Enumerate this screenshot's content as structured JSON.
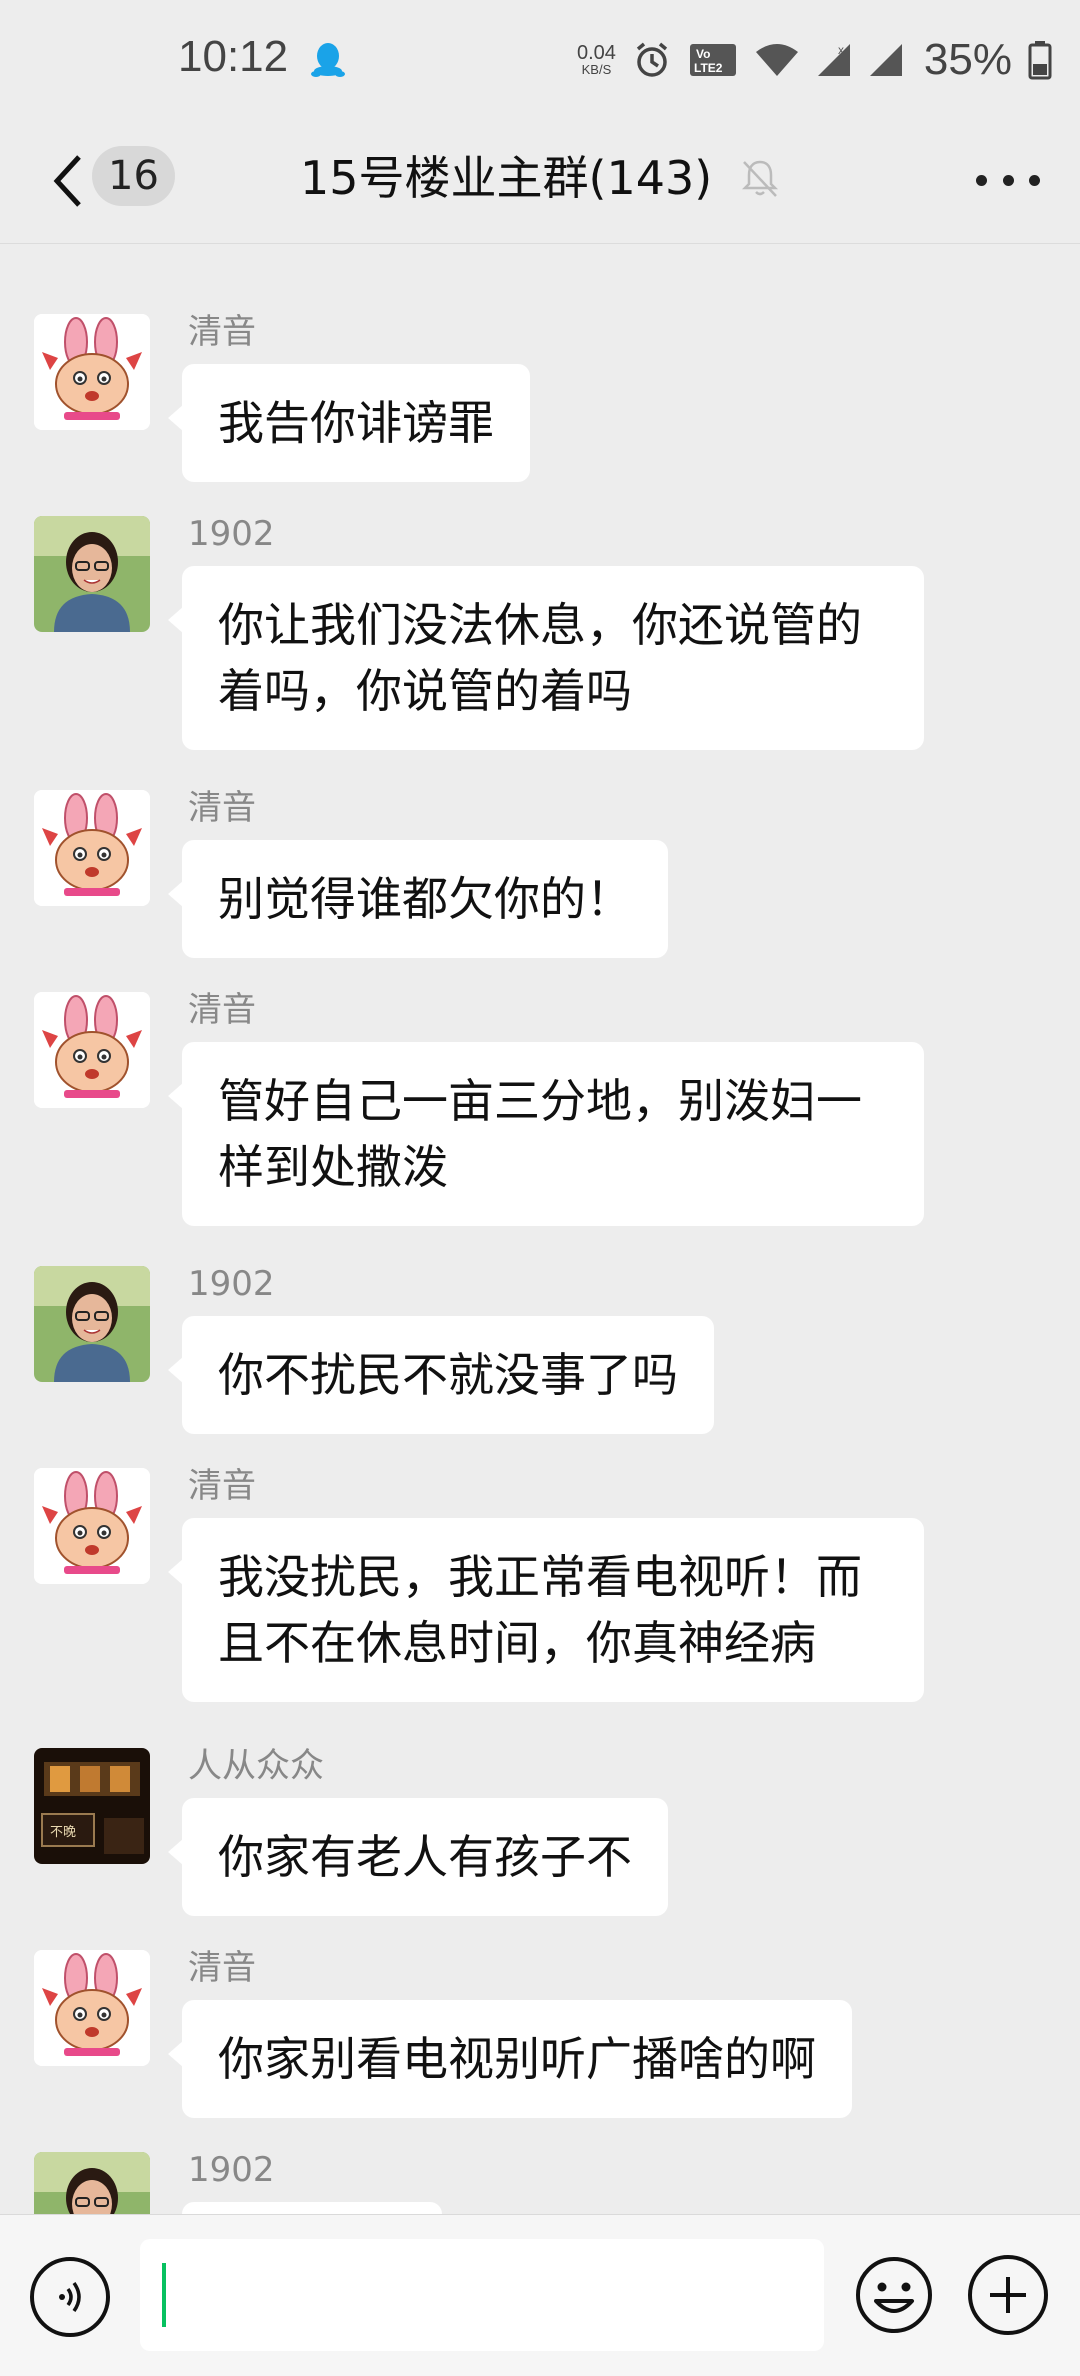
{
  "status_bar": {
    "time": "10:12",
    "net_speed_value": "0.04",
    "net_speed_unit": "KB/S",
    "battery_percent": "35%"
  },
  "header": {
    "unread_count": "16",
    "title": "15号楼业主群(143)"
  },
  "messages": [
    {
      "sender": "清音",
      "avatar": "cartoon-bunny",
      "text": "我告你诽谤罪"
    },
    {
      "sender": "1902",
      "avatar": "woman-photo",
      "text": "你让我们没法休息，你还说管的着吗，你说管的着吗"
    },
    {
      "sender": "清音",
      "avatar": "cartoon-bunny",
      "text": "别觉得谁都欠你的！"
    },
    {
      "sender": "清音",
      "avatar": "cartoon-bunny",
      "text": "管好自己一亩三分地，别泼妇一样到处撒泼"
    },
    {
      "sender": "1902",
      "avatar": "woman-photo",
      "text": "你不扰民不就没事了吗"
    },
    {
      "sender": "清音",
      "avatar": "cartoon-bunny",
      "text": "我没扰民，我正常看电视听！而且不在休息时间，你真神经病"
    },
    {
      "sender": "人从众众",
      "avatar": "dark-room-photo",
      "text": "你家有老人有孩子不"
    },
    {
      "sender": "清音",
      "avatar": "cartoon-bunny",
      "text": "你家别看电视别听广播啥的啊"
    },
    {
      "sender": "1902",
      "avatar": "woman-photo",
      "text": ""
    }
  ],
  "colors": {
    "background": "#ededed",
    "bubble": "#ffffff",
    "accent": "#07c160"
  },
  "icons": {
    "voice": "voice-icon",
    "emoji": "emoji-icon",
    "plus": "plus-icon",
    "back": "back-chevron-icon",
    "mute": "mute-bell-icon",
    "more": "more-dots-icon"
  }
}
